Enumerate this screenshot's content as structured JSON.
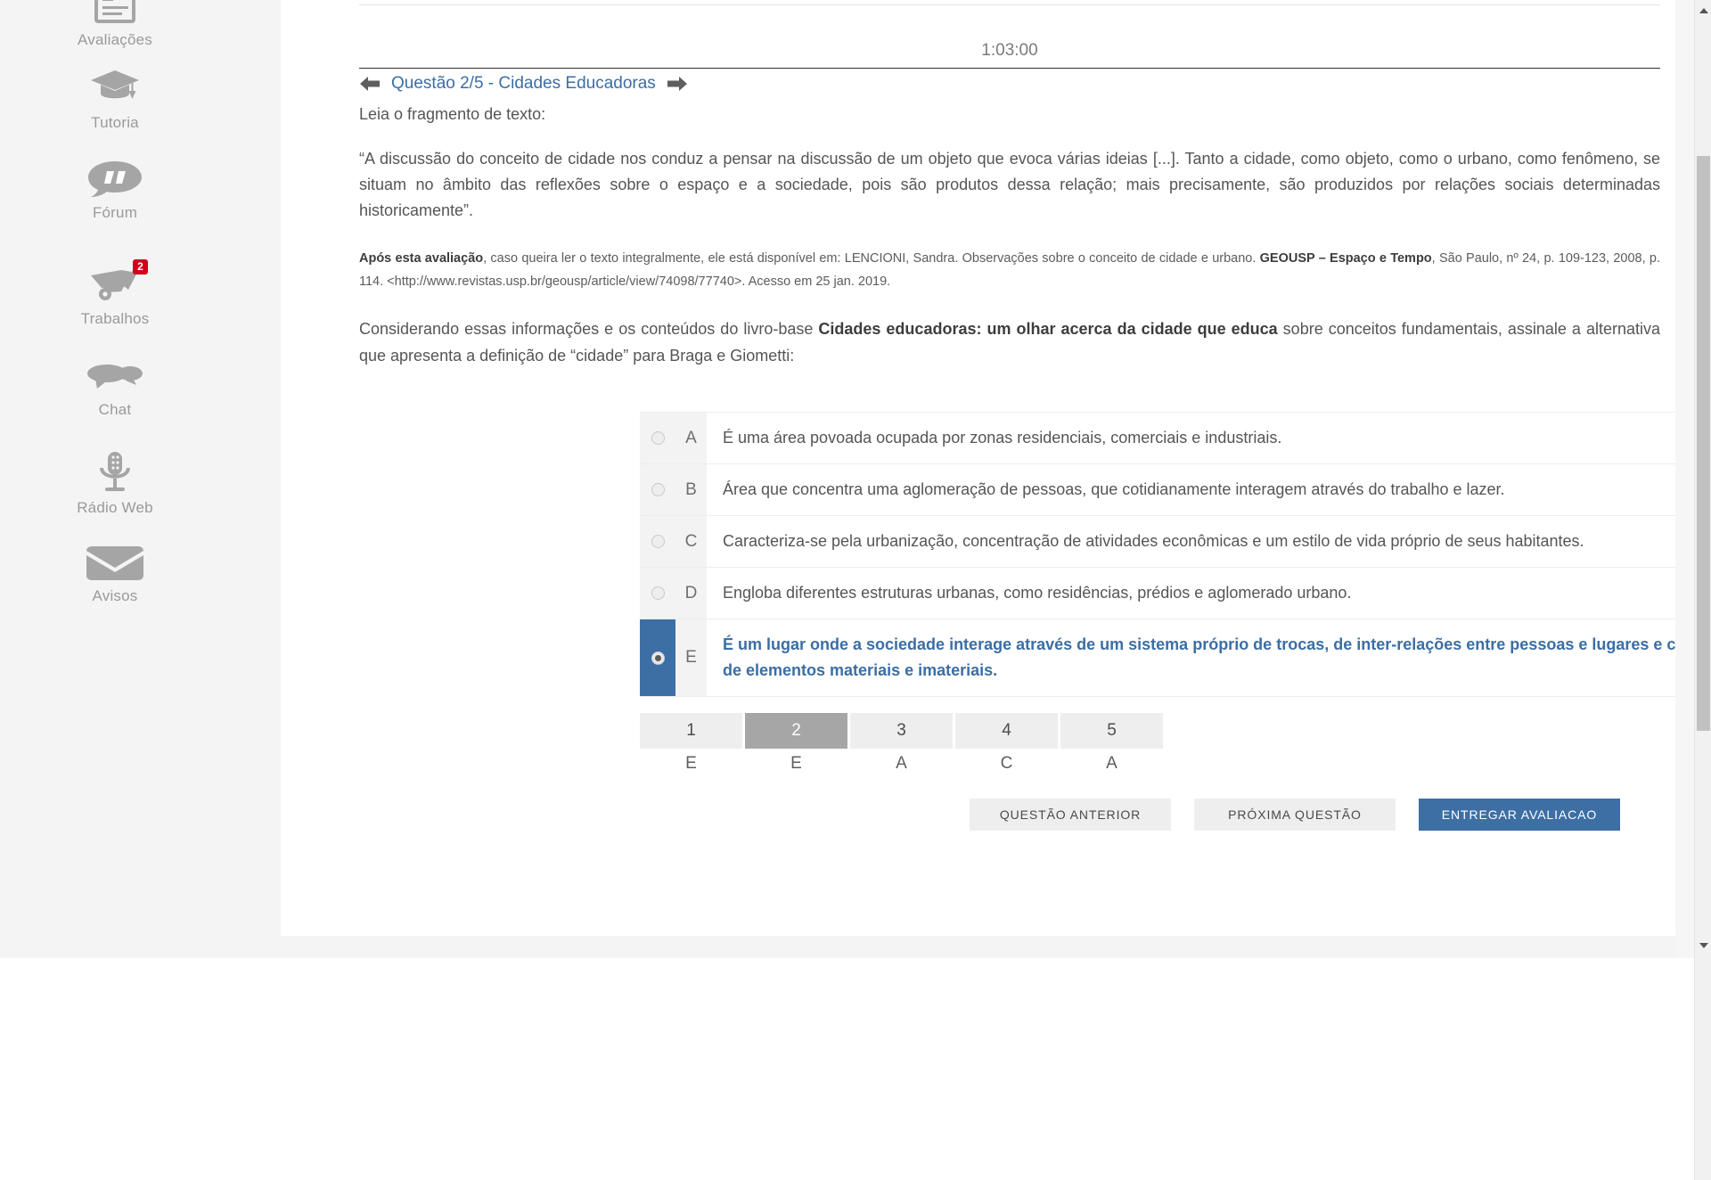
{
  "sidebar": {
    "items": [
      {
        "label": "Avaliações",
        "icon": "clipboard-assessment-icon",
        "badge": null
      },
      {
        "label": "Tutoria",
        "icon": "graduation-cap-icon",
        "badge": null
      },
      {
        "label": "Fórum",
        "icon": "quote-bubble-icon",
        "badge": null
      },
      {
        "label": "Trabalhos",
        "icon": "wheelbarrow-icon",
        "badge": "2"
      },
      {
        "label": "Chat",
        "icon": "chat-bubbles-icon",
        "badge": null
      },
      {
        "label": "Rádio Web",
        "icon": "microphone-icon",
        "badge": null
      },
      {
        "label": "Avisos",
        "icon": "envelope-icon",
        "badge": null
      }
    ]
  },
  "exam": {
    "timer": "1:03:00",
    "question_header": "Questão 2/5 - Cidades Educadoras",
    "prev_arrow_icon": "arrow-left-icon",
    "next_arrow_icon": "arrow-right-icon",
    "lead": "Leia o fragmento de texto:",
    "quote": "“A discussão do conceito de cidade nos conduz a pensar na discussão de um objeto que evoca várias ideias [...]. Tanto a cidade, como objeto, como o urbano, como fenômeno, se situam no âmbito das reflexões sobre o espaço e a sociedade, pois são produtos dessa relação; mais precisamente, são produzidos por relações sociais determinadas historicamente”.",
    "reference": {
      "bold_lead": "Após esta avaliação",
      "part1": ", caso queira ler o texto integralmente, ele está disponível em: LENCIONI, Sandra. Observações sobre o conceito de cidade e urbano. ",
      "bold_journal": "GEOUSP – Espaço e Tempo",
      "part2": ", São Paulo, nº 24, p. 109-123, 2008, p. 114. <http://www.revistas.usp.br/geousp/article/view/74098/77740>. Acesso em 25 jan. 2019."
    },
    "stem": {
      "part1": "Considerando essas informações e os conteúdos do livro-base ",
      "bold_title": "Cidades educadoras: um olhar acerca da cidade que educa",
      "part2": " sobre conceitos fundamentais, assinale a alternativa que apresenta a definição de “cidade” para Braga e Giometti:"
    },
    "alternatives": [
      {
        "letter": "A",
        "text": "É uma área povoada ocupada por zonas residenciais, comerciais e industriais.",
        "selected": false
      },
      {
        "letter": "B",
        "text": "Área que concentra uma aglomeração de pessoas, que cotidianamente interagem através do trabalho e lazer.",
        "selected": false
      },
      {
        "letter": "C",
        "text": "Caracteriza-se pela urbanização, concentração de atividades econômicas e um estilo de vida próprio de seus habitantes.",
        "selected": false
      },
      {
        "letter": "D",
        "text": "Engloba diferentes estruturas urbanas, como residências, prédios e aglomerado urbano.",
        "selected": false
      },
      {
        "letter": "E",
        "text": "É um lugar onde a sociedade interage através de um sistema próprio de trocas, de inter-relações entre pessoas e lugares e comércio, num fluxo constante de elementos materiais e imateriais.",
        "selected": true
      }
    ],
    "question_nav": [
      {
        "number": "1",
        "answer": "E",
        "active": false
      },
      {
        "number": "2",
        "answer": "E",
        "active": true
      },
      {
        "number": "3",
        "answer": "A",
        "active": false
      },
      {
        "number": "4",
        "answer": "C",
        "active": false
      },
      {
        "number": "5",
        "answer": "A",
        "active": false
      }
    ],
    "buttons": {
      "previous": "QUESTÃO ANTERIOR",
      "next": "PRÓXIMA QUESTÃO",
      "submit": "ENTREGAR AVALIACAO"
    }
  },
  "colors": {
    "accent_blue": "#3d6fa4",
    "link_blue": "#3b6ea5",
    "badge_red": "#d0021b",
    "active_gray": "#a6a6a6"
  }
}
